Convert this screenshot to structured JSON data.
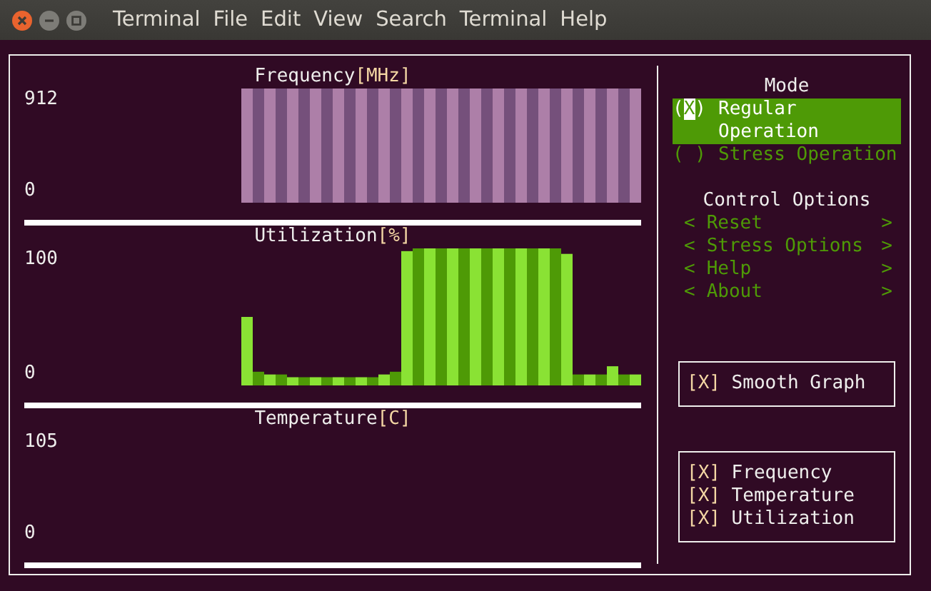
{
  "window": {
    "menu": [
      "Terminal",
      "File",
      "Edit",
      "View",
      "Search",
      "Terminal",
      "Help"
    ]
  },
  "panels": [
    {
      "kind": "frequency",
      "title": "Frequency",
      "unit": "[MHz]",
      "y_labels": [
        "912",
        "0"
      ]
    },
    {
      "kind": "utilization",
      "title": "Utilization",
      "unit": "[%]",
      "y_labels": [
        "100",
        "0"
      ]
    },
    {
      "kind": "temperature",
      "title": "Temperature",
      "unit": "[C]",
      "y_labels": [
        "105",
        "0"
      ]
    }
  ],
  "mode": {
    "title": "Mode",
    "options": [
      {
        "indicator": "(X)",
        "label": "Regular Operation",
        "selected": true
      },
      {
        "indicator": "( )",
        "label": "Stress Operation",
        "selected": false
      }
    ]
  },
  "control_options": {
    "title": "Control Options",
    "items": [
      {
        "left": "<",
        "label": "Reset",
        "right": ">"
      },
      {
        "left": "<",
        "label": "Stress Options",
        "right": ">"
      },
      {
        "left": "<",
        "label": "Help",
        "right": ">"
      },
      {
        "left": "<",
        "label": "About",
        "right": ">"
      }
    ]
  },
  "smooth_graph": {
    "box": "[X]",
    "label": "Smooth Graph",
    "checked": true
  },
  "visibility": [
    {
      "box": "[X]",
      "label": "Frequency",
      "checked": true
    },
    {
      "box": "[X]",
      "label": "Temperature",
      "checked": true
    },
    {
      "box": "[X]",
      "label": "Utilization",
      "checked": true
    }
  ]
}
